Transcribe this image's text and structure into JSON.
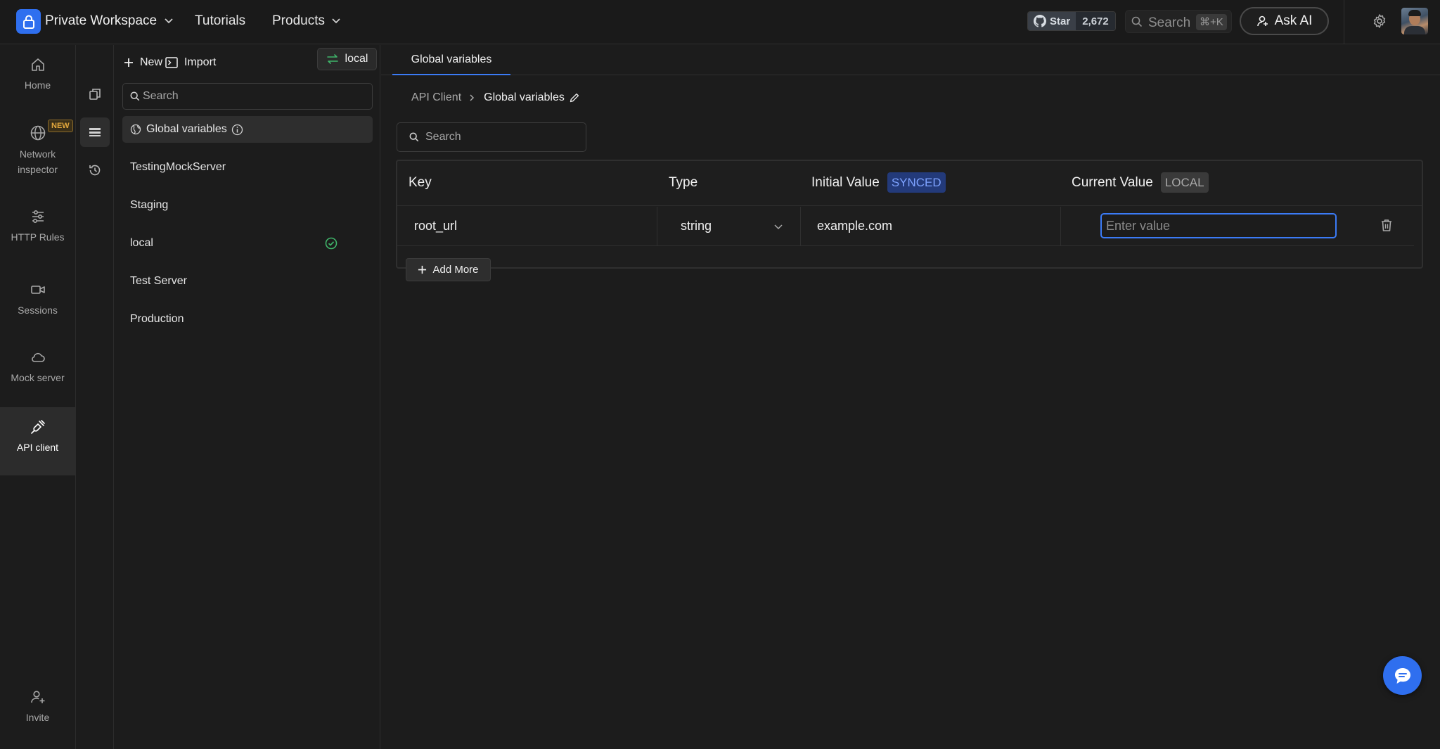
{
  "topbar": {
    "workspace": "Private Workspace",
    "tutorials": "Tutorials",
    "products": "Products",
    "github_star": "Star",
    "github_count": "2,672",
    "search_label": "Search",
    "search_shortcut": "⌘+K",
    "ask_ai": "Ask AI"
  },
  "rail": {
    "items": [
      {
        "label": "Home",
        "icon": "home-icon"
      },
      {
        "label": "Network inspector",
        "icon": "globe-icon",
        "badge": "NEW"
      },
      {
        "label": "HTTP Rules",
        "icon": "sliders-icon"
      },
      {
        "label": "Sessions",
        "icon": "video-icon"
      },
      {
        "label": "Mock server",
        "icon": "cloud-icon"
      },
      {
        "label": "API client",
        "icon": "plug-icon",
        "active": true
      },
      {
        "label": "Invite",
        "icon": "user-plus-icon"
      }
    ]
  },
  "envpanel": {
    "new_label": "New",
    "import_label": "Import",
    "active_env": "local",
    "search_placeholder": "Search",
    "items": [
      {
        "label": "Global variables",
        "selected": true
      },
      {
        "label": "TestingMockServer"
      },
      {
        "label": "Staging"
      },
      {
        "label": "local",
        "active": true
      },
      {
        "label": "Test Server"
      },
      {
        "label": "Production"
      }
    ]
  },
  "main": {
    "tab": "Global variables",
    "breadcrumb_root": "API Client",
    "breadcrumb_current": "Global variables",
    "search_placeholder": "Search",
    "columns": {
      "key": "Key",
      "type": "Type",
      "initial": "Initial Value",
      "initial_badge": "SYNCED",
      "current": "Current Value",
      "current_badge": "LOCAL"
    },
    "row": {
      "key": "root_url",
      "type": "string",
      "initial": "example.com",
      "current_placeholder": "Enter value"
    },
    "add_more": "Add More"
  },
  "colors": {
    "accent": "#3b7bf6",
    "background": "#1c1c1c",
    "success": "#3fb56a",
    "new_badge": "#e2a73c"
  }
}
